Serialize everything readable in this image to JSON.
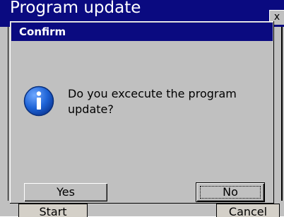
{
  "background_window": {
    "title": "Program update",
    "close_label": "x",
    "start_label": "Start",
    "cancel_label": "Cancel"
  },
  "dialog": {
    "title": "Confirm",
    "icon": "info-icon",
    "message": "Do you excecute the program update?",
    "buttons": {
      "yes": "Yes",
      "no": "No"
    }
  },
  "colors": {
    "titlebar": "#0a0a80",
    "face": "#c0c0c0",
    "icon_blue": "#1e63d6"
  }
}
